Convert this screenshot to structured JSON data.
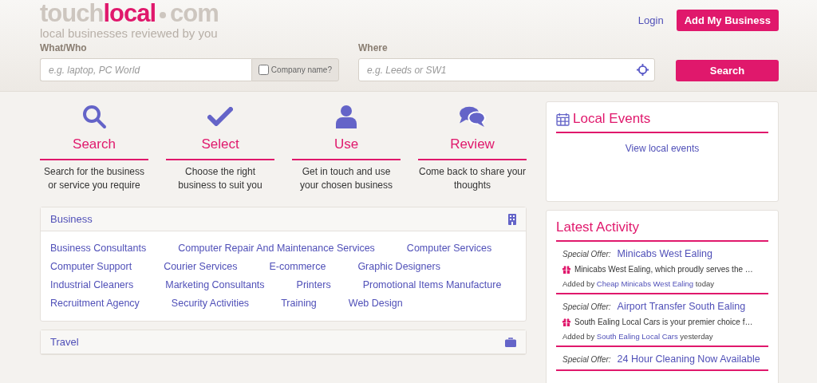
{
  "header": {
    "logo": {
      "part_1": "touch",
      "part_2": "local",
      "part_3": "com"
    },
    "tagline": "local businesses reviewed by you",
    "login": "Login",
    "add_business": "Add My Business"
  },
  "search": {
    "what_label": "What/Who",
    "what_placeholder": "e.g. laptop, PC World",
    "company_name": {
      "label": "Company name?",
      "checked": false
    },
    "where_label": "Where",
    "where_placeholder": "e.g. Leeds or SW1",
    "button": "Search"
  },
  "steps": [
    {
      "kind": "search",
      "title": "Search",
      "text": "Search for the business or service you require"
    },
    {
      "kind": "select",
      "title": "Select",
      "text": "Choose the right business to suit you"
    },
    {
      "kind": "use",
      "title": "Use",
      "text": "Get in touch and use your chosen business"
    },
    {
      "kind": "review",
      "title": "Review",
      "text": "Come back to share your thoughts"
    }
  ],
  "categories": [
    {
      "kind": "business",
      "title": "Business",
      "expanded": true,
      "links": [
        "Business Consultants",
        "Computer Repair And Maintenance Services",
        "Computer Services",
        "Computer Support",
        "Courier Services",
        "E-commerce",
        "Graphic Designers",
        "Industrial Cleaners",
        "Marketing Consultants",
        "Printers",
        "Promotional Items Manufacture",
        "Recruitment Agency",
        "Security Activities",
        "Training",
        "Web Design"
      ]
    },
    {
      "kind": "travel",
      "title": "Travel",
      "expanded": false
    }
  ],
  "local_events": {
    "title": "Local Events",
    "link": "View local events"
  },
  "latest_activity": {
    "title": "Latest Activity",
    "items": [
      {
        "label": "Special Offer:",
        "title": "Minicabs West Ealing",
        "text": "Minicabs West Ealing, which proudly serves the …",
        "added_by": "Added by",
        "author": "Cheap Minicabs West Ealing",
        "when": "today"
      },
      {
        "label": "Special Offer:",
        "title": "Airport Transfer South Ealing",
        "text": "South Ealing Local Cars is your premier choice f…",
        "added_by": "Added by",
        "author": "South Ealing Local Cars",
        "when": "yesterday"
      },
      {
        "label": "Special Offer:",
        "title": "24 Hour Cleaning Now Available"
      }
    ]
  }
}
